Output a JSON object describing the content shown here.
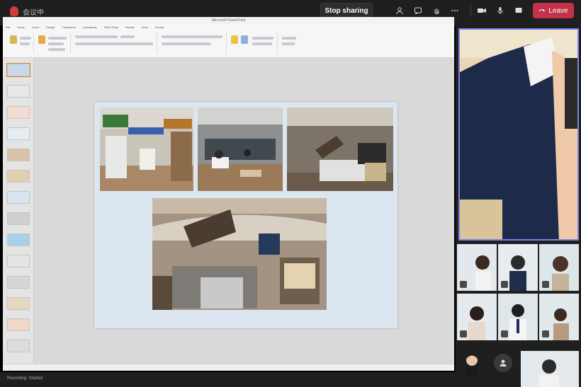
{
  "topbar": {
    "meeting_title": "会议中",
    "stop_button": "Stop sharing",
    "leave_button": "Leave",
    "icons": [
      "people-icon",
      "chat-icon",
      "hand-icon",
      "more-icon",
      "camera-icon",
      "mic-icon",
      "share-icon",
      "phone-icon"
    ]
  },
  "ppt": {
    "window_title": "Microsoft PowerPoint",
    "tabs": [
      "File",
      "Home",
      "Insert",
      "Design",
      "Transitions",
      "Animations",
      "Slide Show",
      "Review",
      "View",
      "Format"
    ]
  },
  "slide": {
    "thumb_count": 14
  },
  "participants": {
    "bottom_label": "Recording: Started"
  },
  "colors": {
    "leave": "#c4314b",
    "accent": "#7b83eb",
    "slide_bg": "#dce6f0"
  }
}
